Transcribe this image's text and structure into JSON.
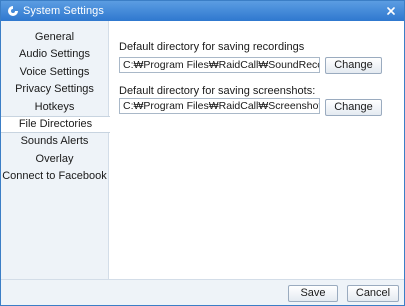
{
  "window": {
    "title": "System Settings"
  },
  "sidebar": {
    "items": [
      {
        "label": "General"
      },
      {
        "label": "Audio Settings"
      },
      {
        "label": "Voice Settings"
      },
      {
        "label": "Privacy Settings"
      },
      {
        "label": "Hotkeys"
      },
      {
        "label": "File Directories"
      },
      {
        "label": "Sounds Alerts"
      },
      {
        "label": "Overlay"
      },
      {
        "label": "Connect to Facebook"
      }
    ],
    "active": "File Directories"
  },
  "main": {
    "recordings": {
      "label": "Default directory for saving recordings",
      "value": "C:₩Program Files₩RaidCall₩SoundRecord",
      "button": "Change"
    },
    "screenshots": {
      "label": "Default directory for saving screenshots:",
      "value": "C:₩Program Files₩RaidCall₩Screenshot",
      "button": "Change"
    }
  },
  "footer": {
    "save_label": "Save",
    "cancel_label": "Cancel"
  },
  "colors": {
    "titlebar": "#2f78cf",
    "sidebar_bg": "#eef3f8",
    "border": "#3b7ec6"
  },
  "icons": {
    "app": "raidcall-logo-icon",
    "close": "close-icon"
  }
}
